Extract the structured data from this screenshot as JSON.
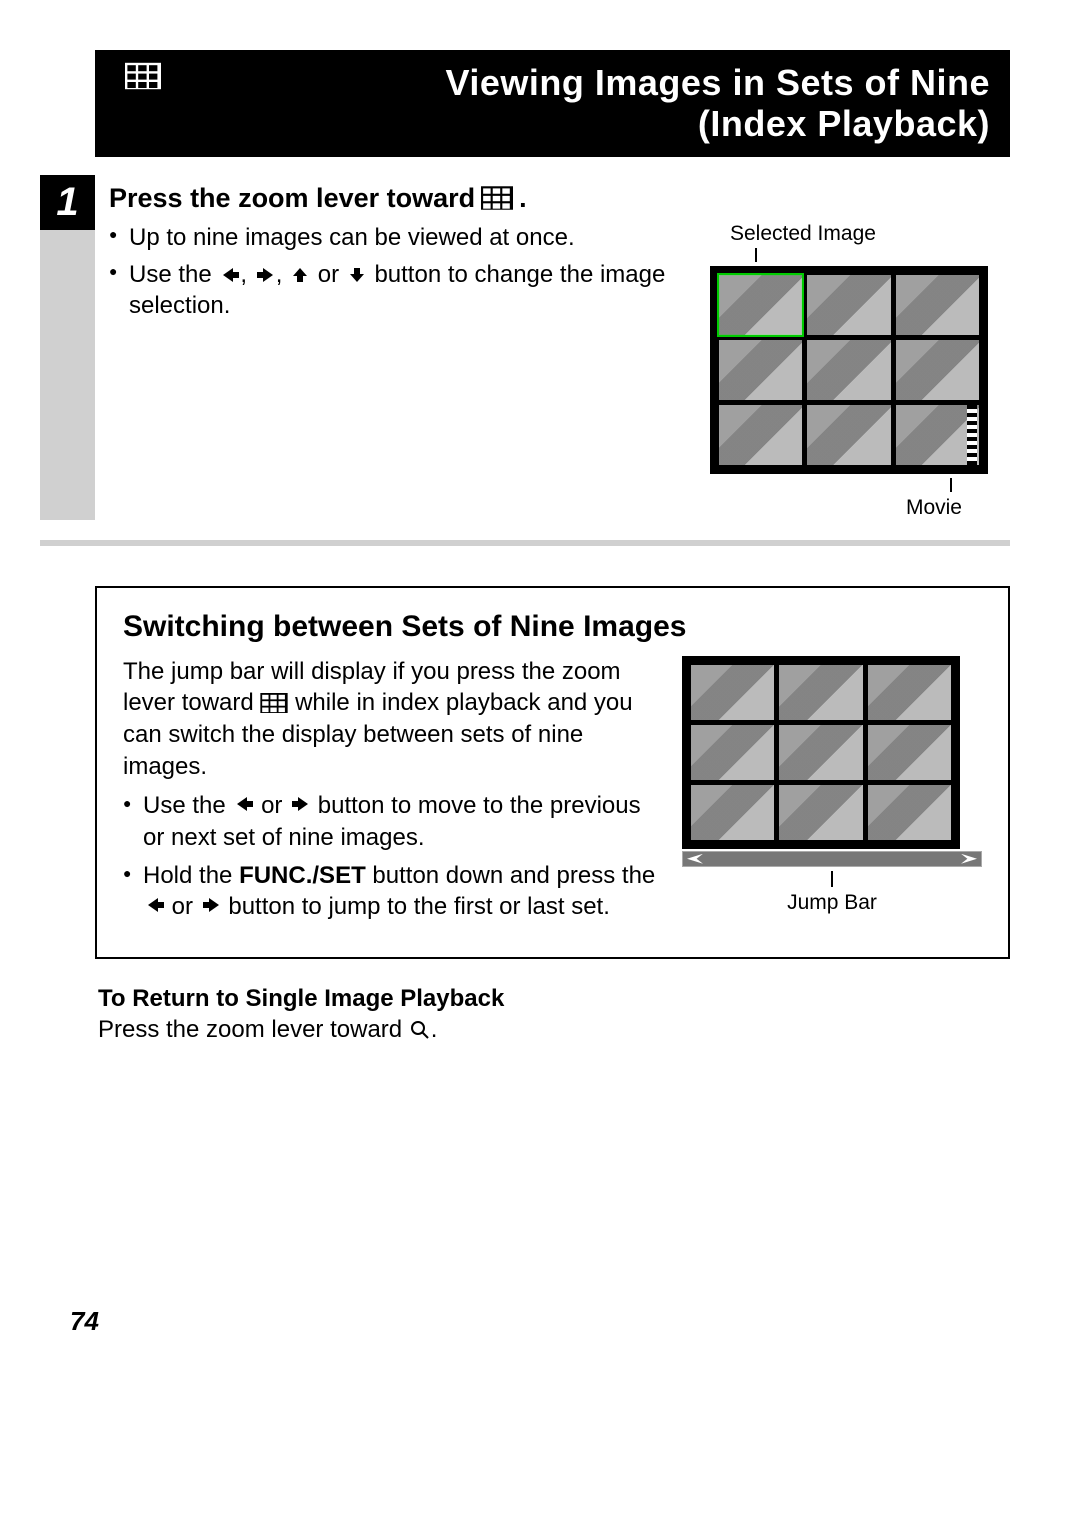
{
  "header": {
    "title_line1": "Viewing Images in Sets of Nine",
    "title_line2": "(Index Playback)"
  },
  "step1": {
    "number": "1",
    "heading_before": "Press the zoom lever toward",
    "heading_after": ".",
    "bullet1": "Up to nine images can be viewed at once.",
    "bullet2_a": "Use the",
    "bullet2_b": "or",
    "bullet2_c": "button to change the image selection.",
    "caption_selected": "Selected Image",
    "caption_movie": "Movie"
  },
  "box": {
    "title": "Switching between Sets of Nine Images",
    "para_a": "The jump bar will display if you press the zoom lever toward",
    "para_b": "while in index playback and you can switch the display between sets of nine images.",
    "bullet1_a": "Use the",
    "bullet1_b": "or",
    "bullet1_c": "button to move to the previous or next set of nine images.",
    "bullet2_a": "Hold the",
    "bullet2_bold": "FUNC./SET",
    "bullet2_b": "button down and press the",
    "bullet2_c": "or",
    "bullet2_d": "button to jump to the first or last set.",
    "caption_jump": "Jump Bar"
  },
  "return": {
    "heading": "To Return to Single Image Playback",
    "body_a": "Press the zoom lever toward",
    "body_b": "."
  },
  "page_number": "74"
}
